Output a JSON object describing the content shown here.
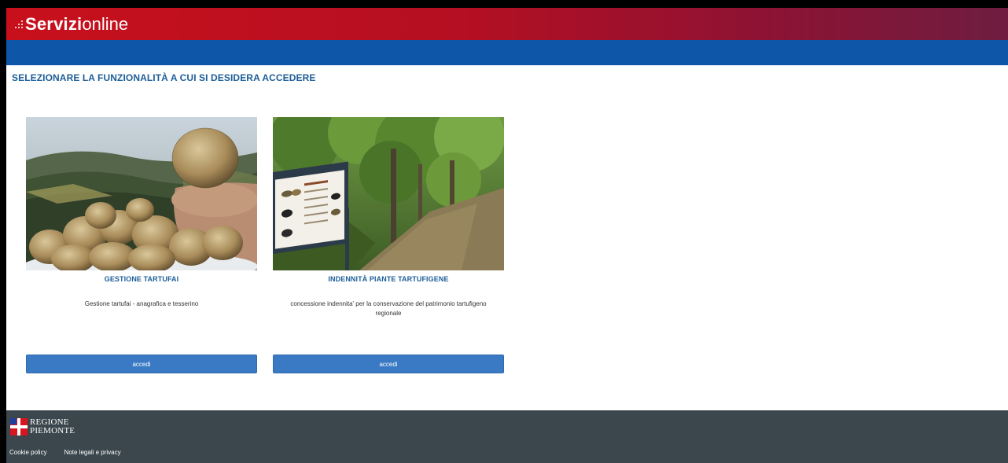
{
  "header": {
    "brand_strong": "Servizi",
    "brand_light": "online"
  },
  "page": {
    "title": "SELEZIONARE LA FUNZIONALITÀ A CUI SI DESIDERA ACCEDERE"
  },
  "cards": [
    {
      "title": "GESTIONE TARTUFAI",
      "description": "Gestione tartufai - anagrafica e tesserino",
      "button": "accedi"
    },
    {
      "title": "INDENNITÀ PIANTE TARTUFIGENE",
      "description": "concessione indennita' per la conservazione del patrimonio tartufigeno regionale",
      "button": "accedi"
    }
  ],
  "footer": {
    "logo_line1": "REGIONE",
    "logo_line2": "PIEMONTE",
    "links": [
      "Cookie policy",
      "Note legali e privacy"
    ]
  },
  "colors": {
    "header_red": "#c8101c",
    "nav_blue": "#0e56a7",
    "title_blue": "#1c5e98",
    "button_blue": "#3a7ac4",
    "footer_gray": "#3b474d"
  }
}
